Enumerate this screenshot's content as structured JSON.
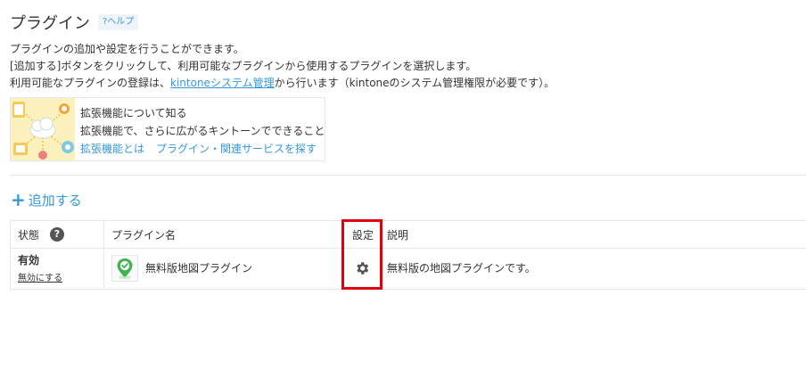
{
  "page": {
    "title": "プラグイン",
    "help_label": "?ヘルプ"
  },
  "description": {
    "line1": "プラグインの追加や設定を行うことができます。",
    "line2": "[追加する]ボタンをクリックして、利用可能なプラグインから使用するプラグインを選択します。",
    "line3_pre": "利用可能なプラグインの登録は、",
    "line3_link": "kintoneシステム管理",
    "line3_post": "から行います（kintoneのシステム管理権限が必要です）。"
  },
  "extension": {
    "title": "拡張機能について知る",
    "subtitle": "拡張機能で、さらに広がるキントーンでできること",
    "link1": "拡張機能とは",
    "link2": "プラグイン・関連サービスを探す"
  },
  "add_button": {
    "icon": "plus-icon",
    "label": "追加する"
  },
  "table": {
    "headers": {
      "status": "状態",
      "name": "プラグイン名",
      "settings": "設定",
      "description": "説明"
    },
    "rows": [
      {
        "status": "有効",
        "toggle_label": "無効にする",
        "name": "無料版地図プラグイン",
        "settings_icon": "gear-icon",
        "description": "無料版の地図プラグインです。"
      }
    ]
  },
  "colors": {
    "link": "#3498db",
    "highlight": "#e0000d",
    "border": "#e3e7e8"
  }
}
